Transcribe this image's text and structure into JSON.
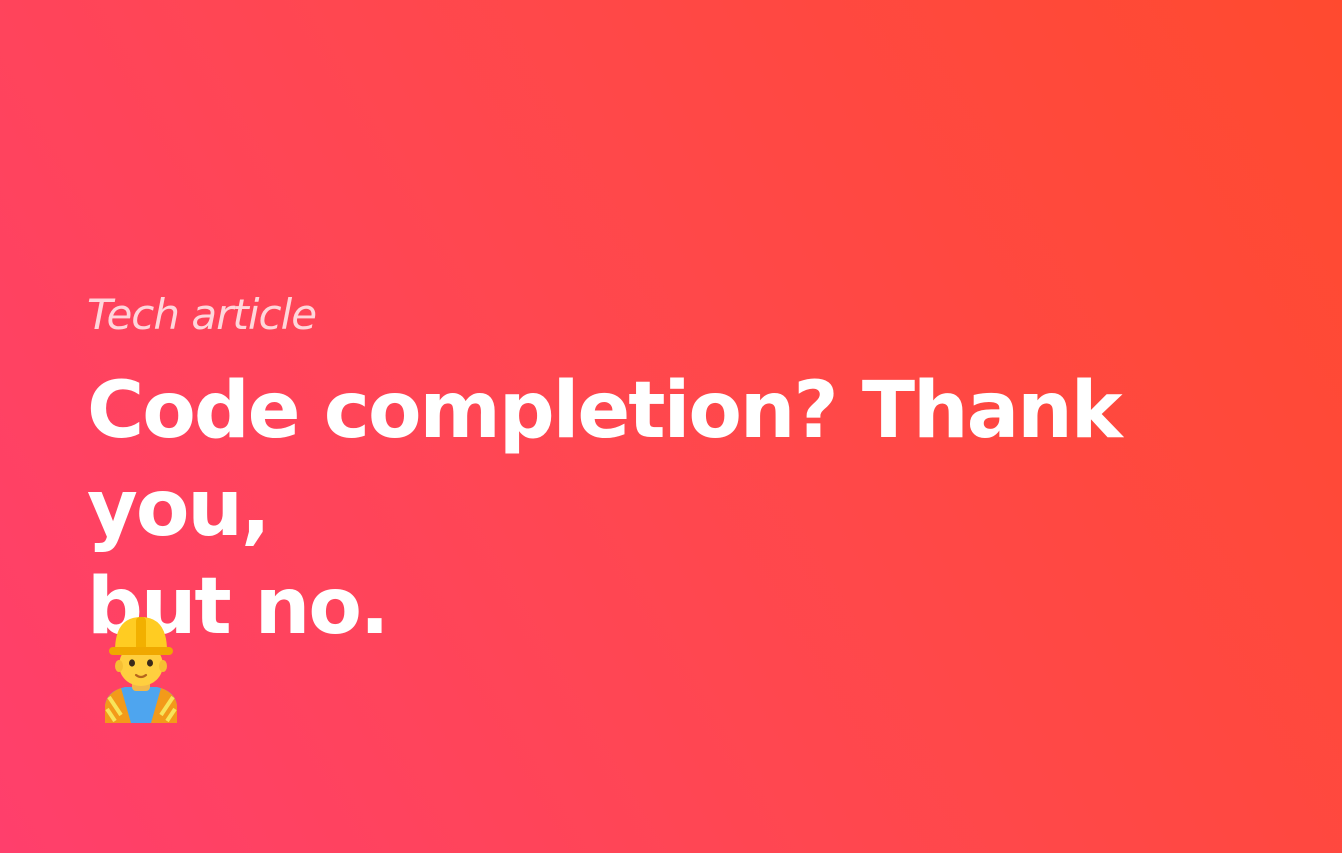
{
  "article": {
    "kicker": "Tech article",
    "headline_line1": "Code completion? Thank you,",
    "headline_line2": "but no.",
    "emoji": "construction-worker-icon"
  }
}
